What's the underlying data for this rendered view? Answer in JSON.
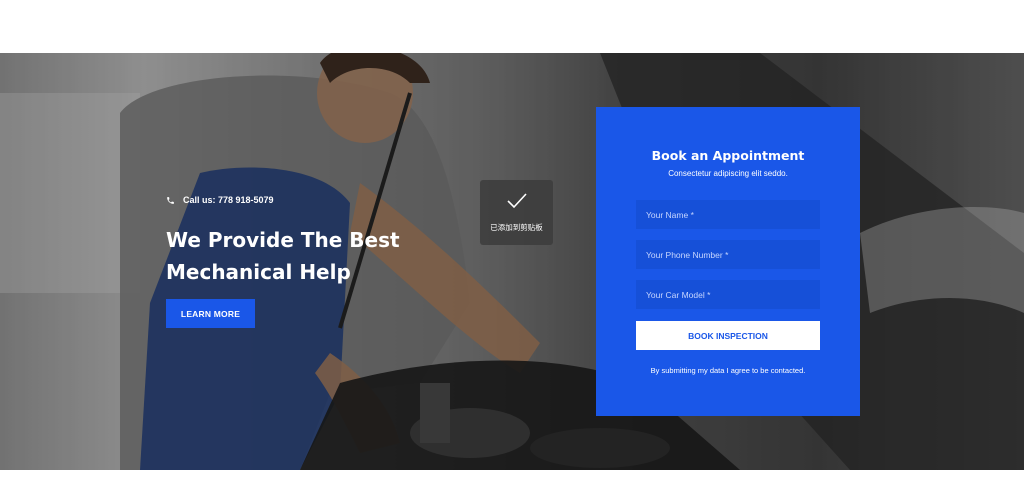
{
  "hero": {
    "call_label": "Call us: 778 918-5079",
    "headline_line1": "We Provide The Best",
    "headline_line2": "Mechanical Help",
    "cta_label": "LEARN MORE"
  },
  "toast": {
    "icon": "check-icon",
    "text": "已添加到剪贴板"
  },
  "form": {
    "title": "Book an Appointment",
    "subtitle": "Consectetur adipiscing elit seddo.",
    "name_placeholder": "Your Name *",
    "phone_placeholder": "Your Phone Number *",
    "car_model_placeholder": "Your Car Model *",
    "submit_label": "BOOK INSPECTION",
    "consent": "By submitting my data I agree to be contacted."
  },
  "colors": {
    "accent": "#1a57e8",
    "field_bg": "#1650d8",
    "text_light": "#ffffff"
  }
}
